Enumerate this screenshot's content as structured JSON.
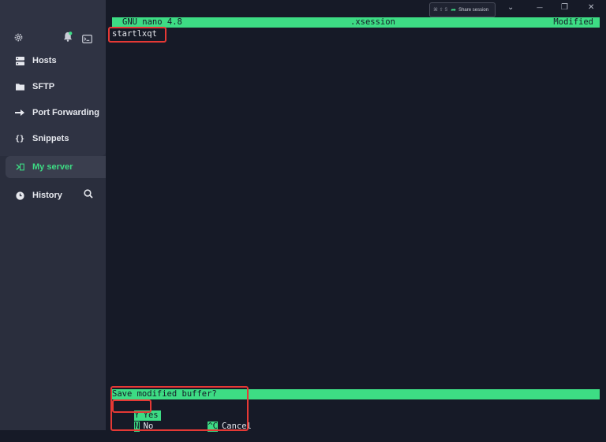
{
  "sidebar": {
    "items": [
      {
        "label": "Hosts",
        "icon": "hosts-icon"
      },
      {
        "label": "SFTP",
        "icon": "folder-icon"
      },
      {
        "label": "Port Forwarding",
        "icon": "arrow-forward-icon"
      },
      {
        "label": "Snippets",
        "icon": "braces-icon"
      }
    ],
    "active": {
      "label": "My server",
      "icon": "terminal-prompt-icon"
    },
    "history": {
      "label": "History",
      "icon": "clock-icon"
    }
  },
  "window": {
    "share_shortcut": "⌘ ⇧ S",
    "share_label": "Share session",
    "minimize": "⌄",
    "min_glyph": "—",
    "restore": "❐",
    "close": "✕"
  },
  "editor": {
    "app": "GNU nano 4.8",
    "filename": ".xsession",
    "status": "Modified",
    "content": "startlxqt",
    "prompt": "Save modified buffer?",
    "options": [
      {
        "key": "Y",
        "label": "Yes"
      },
      {
        "key": "N",
        "label": "No"
      },
      {
        "key": "^C",
        "label": "Cancel"
      }
    ]
  },
  "colors": {
    "accent": "#3ddc84",
    "highlight": "#e53935",
    "background": "#161a27",
    "sidebar": "#2a2e3d"
  }
}
